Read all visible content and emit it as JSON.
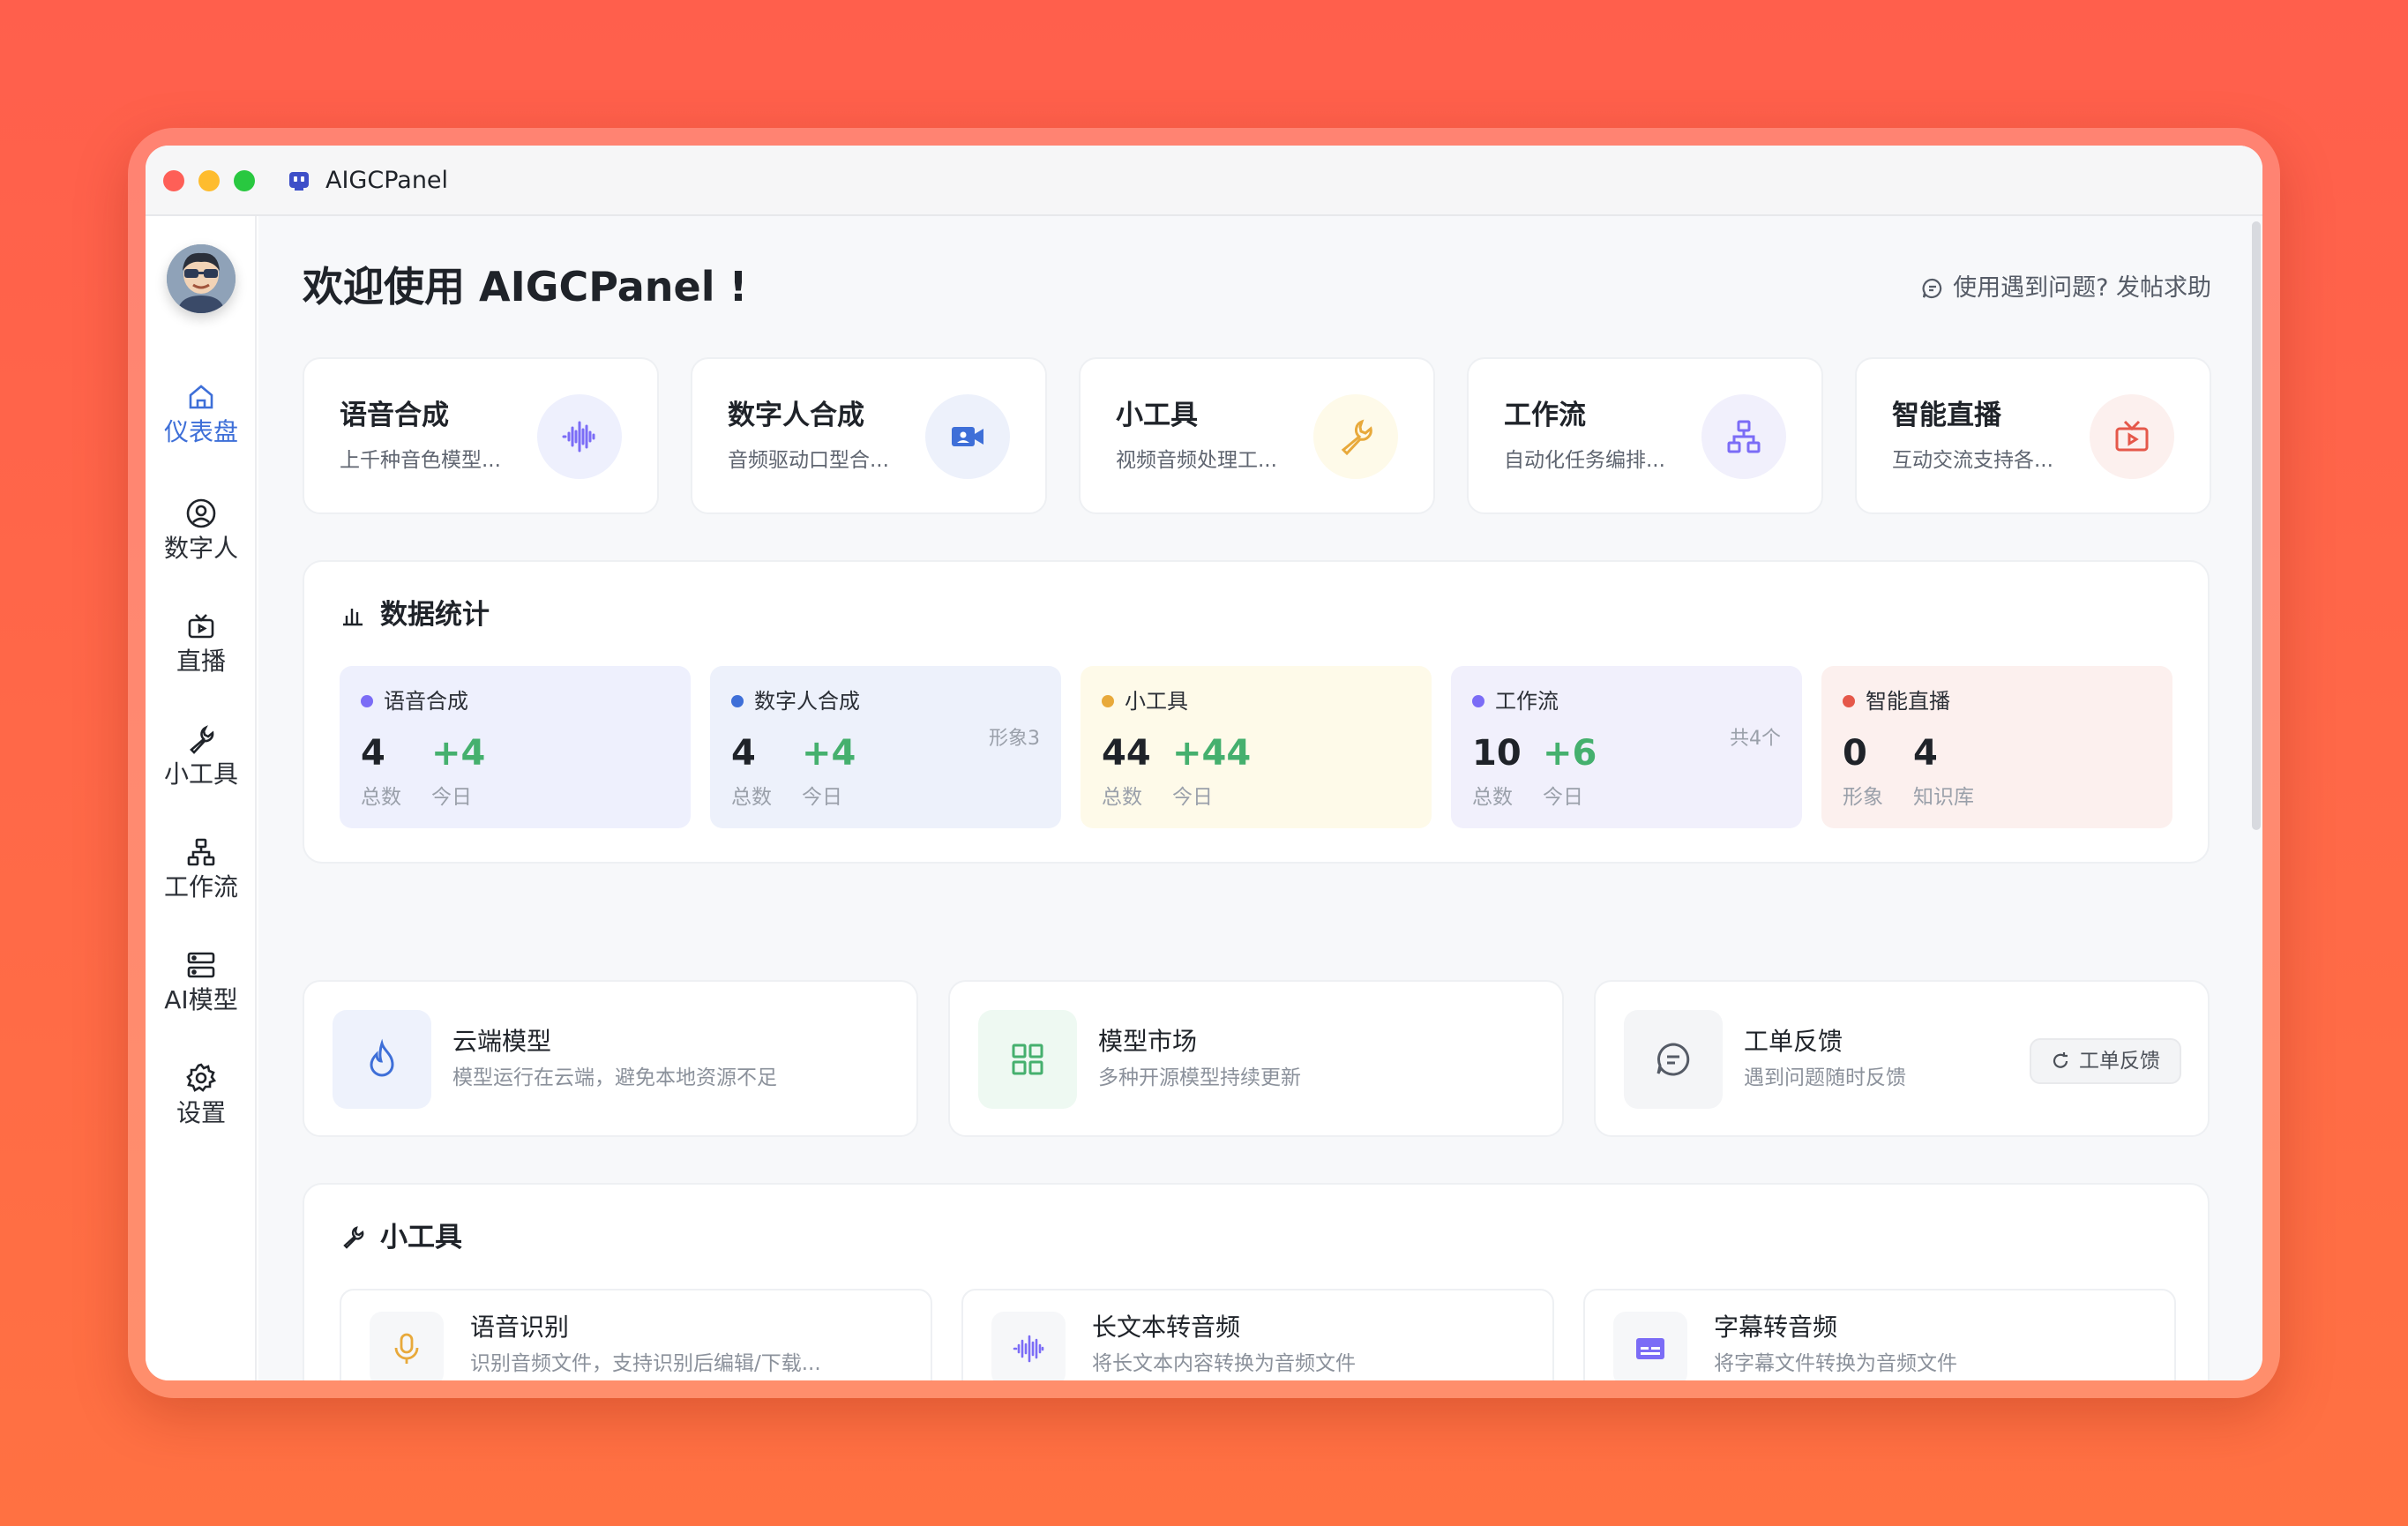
{
  "window": {
    "title": "AIGCPanel"
  },
  "sidebar": {
    "items": [
      {
        "label": "仪表盘",
        "icon": "home-icon",
        "active": true
      },
      {
        "label": "数字人",
        "icon": "user-circle-icon"
      },
      {
        "label": "直播",
        "icon": "tv-icon"
      },
      {
        "label": "小工具",
        "icon": "wrench-icon"
      },
      {
        "label": "工作流",
        "icon": "workflow-icon"
      },
      {
        "label": "AI模型",
        "icon": "server-icon"
      },
      {
        "label": "设置",
        "icon": "gear-icon"
      }
    ]
  },
  "header": {
    "welcome": "欢迎使用 AIGCPanel !",
    "help_link": "使用遇到问题? 发帖求助"
  },
  "features": [
    {
      "title": "语音合成",
      "desc": "上千种音色模型...",
      "icon": "waveform-icon",
      "color": "#7B6CF6"
    },
    {
      "title": "数字人合成",
      "desc": "音频驱动口型合...",
      "icon": "video-camera-icon",
      "color": "#3E6FD8"
    },
    {
      "title": "小工具",
      "desc": "视频音频处理工...",
      "icon": "wrench-icon",
      "color": "#E8A93B"
    },
    {
      "title": "工作流",
      "desc": "自动化任务编排...",
      "icon": "workflow-icon",
      "color": "#7B6CF6"
    },
    {
      "title": "智能直播",
      "desc": "互动交流支持各...",
      "icon": "tv-play-icon",
      "color": "#E5584A"
    }
  ],
  "stats": {
    "title": "数据统计",
    "cards": [
      {
        "name": "语音合成",
        "dot": "#7B6CF6",
        "bg": "#EEF0FD",
        "v1": "4",
        "v2": "+4",
        "l1": "总数",
        "l2": "今日",
        "extra": ""
      },
      {
        "name": "数字人合成",
        "dot": "#3E6FD8",
        "bg": "#EDF1FB",
        "v1": "4",
        "v2": "+4",
        "l1": "总数",
        "l2": "今日",
        "extra": "形象3"
      },
      {
        "name": "小工具",
        "dot": "#E8A93B",
        "bg": "#FEFAE9",
        "v1": "44",
        "v2": "+44",
        "l1": "总数",
        "l2": "今日",
        "extra": ""
      },
      {
        "name": "工作流",
        "dot": "#7B6CF6",
        "bg": "#F1F0FC",
        "v1": "10",
        "v2": "+6",
        "l1": "总数",
        "l2": "今日",
        "extra": "共4个"
      },
      {
        "name": "智能直播",
        "dot": "#E5584A",
        "bg": "#FCF0EE",
        "v1": "0",
        "v2": "4",
        "l1": "形象",
        "l2": "知识库",
        "extra": ""
      }
    ]
  },
  "quick_links": [
    {
      "title": "云端模型",
      "desc": "模型运行在云端，避免本地资源不足",
      "icon": "flame-icon",
      "color": "#3E6FD8",
      "bg": "#EEF2FC"
    },
    {
      "title": "模型市场",
      "desc": "多种开源模型持续更新",
      "icon": "grid-icon",
      "color": "#45B06E",
      "bg": "#EEF9F2"
    },
    {
      "title": "工单反馈",
      "desc": "遇到问题随时反馈",
      "icon": "chat-icon",
      "color": "#555b66",
      "bg": "#F4F5F7",
      "button": "工单反馈"
    }
  ],
  "tools": {
    "title": "小工具",
    "items": [
      {
        "title": "语音识别",
        "desc": "识别音频文件，支持识别后编辑/下载...",
        "icon": "microphone-icon",
        "color": "#E8A93B"
      },
      {
        "title": "长文本转音频",
        "desc": "将长文本内容转换为音频文件",
        "icon": "waveform-icon",
        "color": "#7B6CF6"
      },
      {
        "title": "字幕转音频",
        "desc": "将字幕文件转换为音频文件",
        "icon": "subtitles-icon",
        "color": "#7B6CF6"
      }
    ]
  }
}
